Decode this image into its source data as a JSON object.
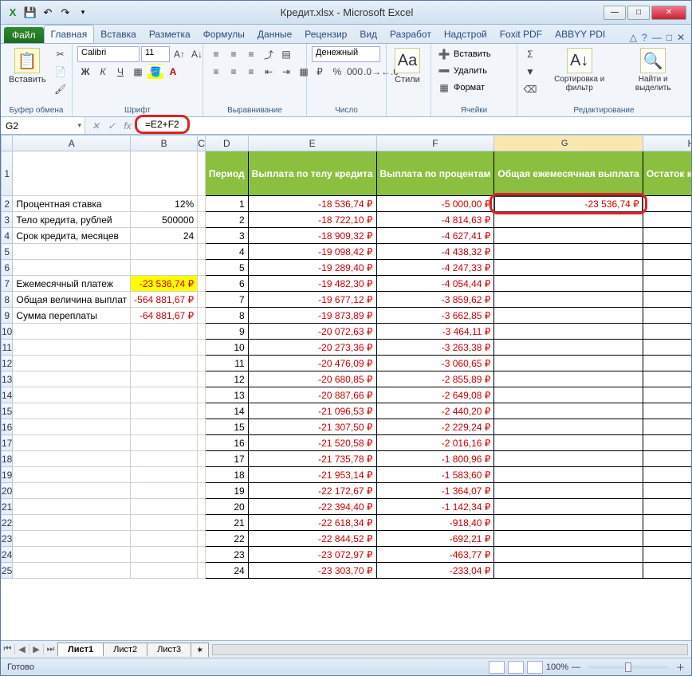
{
  "window": {
    "title": "Кредит.xlsx - Microsoft Excel"
  },
  "ribbon": {
    "file": "Файл",
    "tabs": [
      "Главная",
      "Вставка",
      "Разметка",
      "Формулы",
      "Данные",
      "Рецензир",
      "Вид",
      "Разработ",
      "Надстрой",
      "Foxit PDF",
      "ABBYY PDI"
    ],
    "active": 0,
    "groups": {
      "clipboard": "Буфер обмена",
      "paste": "Вставить",
      "font": "Шрифт",
      "font_name": "Calibri",
      "font_size": "11",
      "alignment": "Выравнивание",
      "number": "Число",
      "number_format": "Денежный",
      "styles": "Стили",
      "cells": "Ячейки",
      "insert": "Вставить",
      "delete": "Удалить",
      "format": "Формат",
      "editing": "Редактирование",
      "sort": "Сортировка и фильтр",
      "find": "Найти и выделить"
    }
  },
  "formula_bar": {
    "name_box": "G2",
    "formula": "=E2+F2"
  },
  "columns": [
    "A",
    "B",
    "C",
    "D",
    "E",
    "F",
    "G",
    "H"
  ],
  "headers": {
    "D": "Период",
    "E": "Выплата по телу кредита",
    "F": "Выплата по процентам",
    "G": "Общая ежемесячная выплата",
    "H": "Остаток к выплате"
  },
  "left_labels": {
    "r2": "Процентная ставка",
    "r3": "Тело кредита, рублей",
    "r4": "Срок кредита, месяцев",
    "r7": "Ежемесячный платеж",
    "r8": "Общая величина выплат",
    "r9": "Сумма переплаты"
  },
  "left_values": {
    "r2": "12%",
    "r3": "500000",
    "r4": "24",
    "r7": "-23 536,74 ₽",
    "r8": "-564 881,67 ₽",
    "r9": "-64 881,67 ₽"
  },
  "g2": "-23 536,74 ₽",
  "payments": [
    {
      "p": 1,
      "e": "-18 536,74 ₽",
      "f": "-5 000,00 ₽"
    },
    {
      "p": 2,
      "e": "-18 722,10 ₽",
      "f": "-4 814,63 ₽"
    },
    {
      "p": 3,
      "e": "-18 909,32 ₽",
      "f": "-4 627,41 ₽"
    },
    {
      "p": 4,
      "e": "-19 098,42 ₽",
      "f": "-4 438,32 ₽"
    },
    {
      "p": 5,
      "e": "-19 289,40 ₽",
      "f": "-4 247,33 ₽"
    },
    {
      "p": 6,
      "e": "-19 482,30 ₽",
      "f": "-4 054,44 ₽"
    },
    {
      "p": 7,
      "e": "-19 677,12 ₽",
      "f": "-3 859,62 ₽"
    },
    {
      "p": 8,
      "e": "-19 873,89 ₽",
      "f": "-3 662,85 ₽"
    },
    {
      "p": 9,
      "e": "-20 072,63 ₽",
      "f": "-3 464,11 ₽"
    },
    {
      "p": 10,
      "e": "-20 273,36 ₽",
      "f": "-3 263,38 ₽"
    },
    {
      "p": 11,
      "e": "-20 476,09 ₽",
      "f": "-3 060,65 ₽"
    },
    {
      "p": 12,
      "e": "-20 680,85 ₽",
      "f": "-2 855,89 ₽"
    },
    {
      "p": 13,
      "e": "-20 887,66 ₽",
      "f": "-2 649,08 ₽"
    },
    {
      "p": 14,
      "e": "-21 096,53 ₽",
      "f": "-2 440,20 ₽"
    },
    {
      "p": 15,
      "e": "-21 307,50 ₽",
      "f": "-2 229,24 ₽"
    },
    {
      "p": 16,
      "e": "-21 520,58 ₽",
      "f": "-2 016,16 ₽"
    },
    {
      "p": 17,
      "e": "-21 735,78 ₽",
      "f": "-1 800,96 ₽"
    },
    {
      "p": 18,
      "e": "-21 953,14 ₽",
      "f": "-1 583,60 ₽"
    },
    {
      "p": 19,
      "e": "-22 172,67 ₽",
      "f": "-1 364,07 ₽"
    },
    {
      "p": 20,
      "e": "-22 394,40 ₽",
      "f": "-1 142,34 ₽"
    },
    {
      "p": 21,
      "e": "-22 618,34 ₽",
      "f": "-918,40 ₽"
    },
    {
      "p": 22,
      "e": "-22 844,52 ₽",
      "f": "-692,21 ₽"
    },
    {
      "p": 23,
      "e": "-23 072,97 ₽",
      "f": "-463,77 ₽"
    },
    {
      "p": 24,
      "e": "-23 303,70 ₽",
      "f": "-233,04 ₽"
    }
  ],
  "sheets": [
    "Лист1",
    "Лист2",
    "Лист3"
  ],
  "status": {
    "ready": "Готово",
    "zoom": "100%"
  }
}
